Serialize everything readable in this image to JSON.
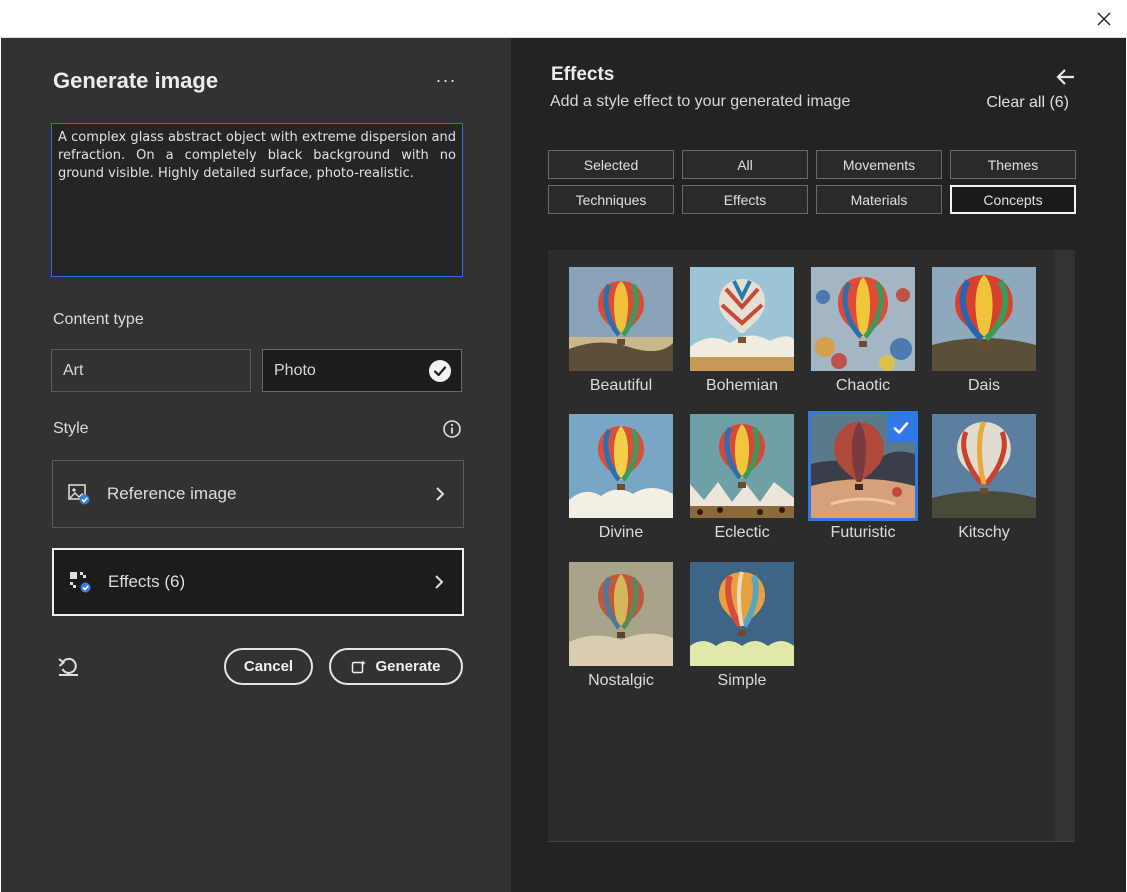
{
  "window": {
    "close_label": "✕"
  },
  "generate": {
    "title": "Generate image",
    "more_label": "···",
    "prompt": "A complex glass abstract object with extreme dispersion and refraction. On a completely black background with no ground visible. Highly detailed surface, photo-realistic.",
    "content_type_label": "Content type",
    "content_types": [
      {
        "label": "Art",
        "selected": false
      },
      {
        "label": "Photo",
        "selected": true
      }
    ],
    "style_label": "Style",
    "reference_image_label": "Reference image",
    "effects_label": "Effects (6)",
    "cancel_label": "Cancel",
    "generate_label": "Generate"
  },
  "effects": {
    "title": "Effects",
    "subtitle": "Add a style effect to your generated image",
    "clear_all_label": "Clear all (6)",
    "categories": [
      "Selected",
      "All",
      "Movements",
      "Themes",
      "Techniques",
      "Effects",
      "Materials",
      "Concepts"
    ],
    "active_category": "Concepts",
    "tiles": [
      {
        "label": "Beautiful",
        "selected": false
      },
      {
        "label": "Bohemian",
        "selected": false
      },
      {
        "label": "Chaotic",
        "selected": false
      },
      {
        "label": "Dais",
        "selected": false
      },
      {
        "label": "Divine",
        "selected": false
      },
      {
        "label": "Eclectic",
        "selected": false
      },
      {
        "label": "Futuristic",
        "selected": true
      },
      {
        "label": "Kitschy",
        "selected": false
      },
      {
        "label": "Nostalgic",
        "selected": false
      },
      {
        "label": "Simple",
        "selected": false
      }
    ]
  },
  "colors": {
    "accent": "#2f78e6",
    "panel_left": "#323232",
    "panel_right": "#232323"
  }
}
